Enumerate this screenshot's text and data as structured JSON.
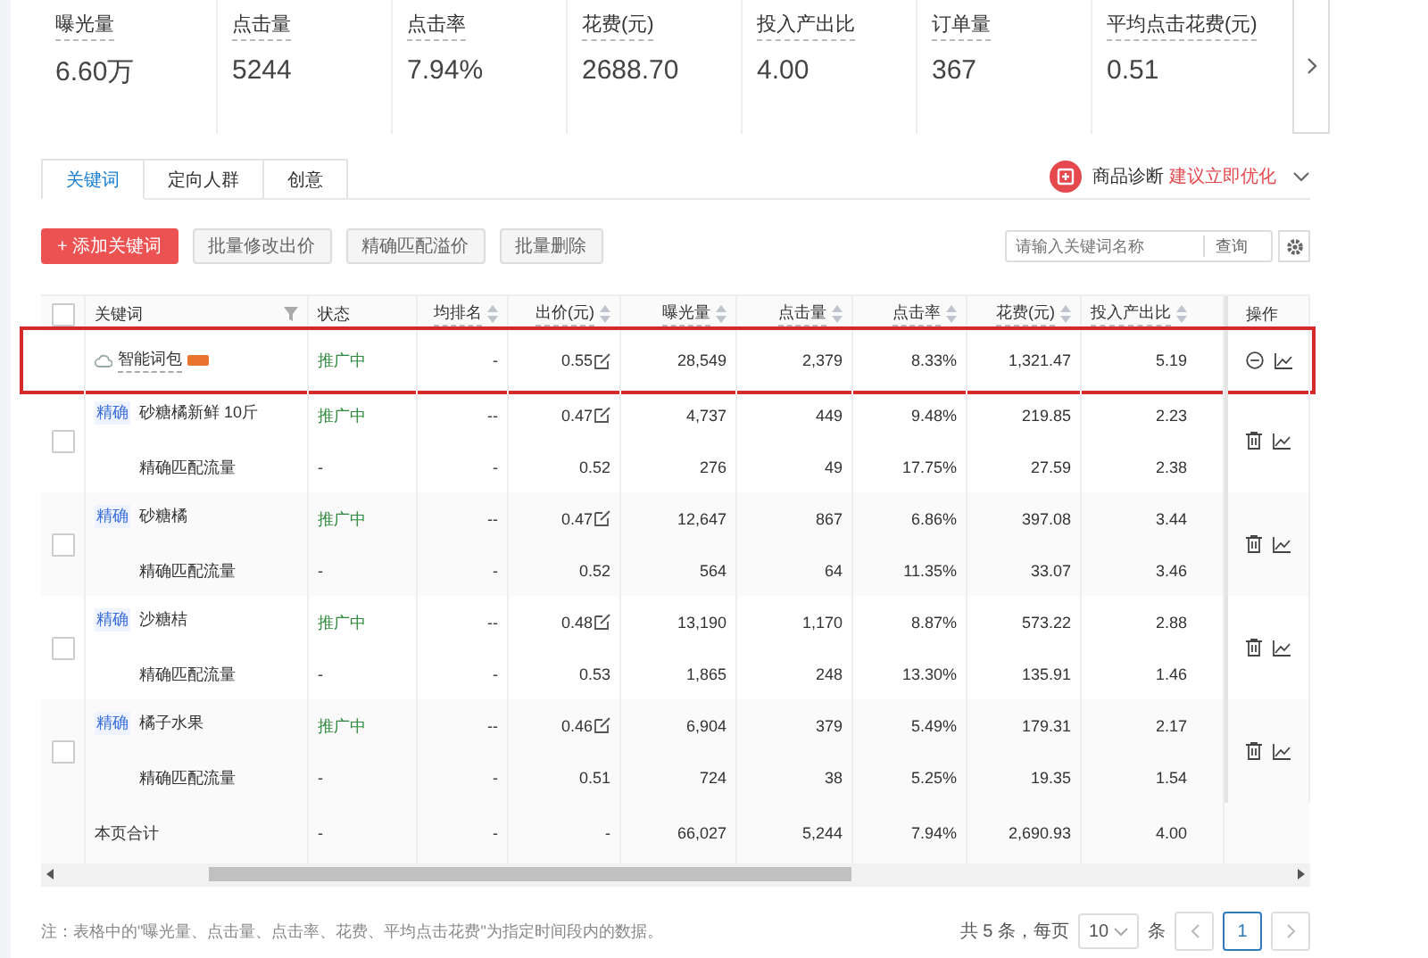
{
  "stats": [
    {
      "label": "曝光量",
      "value": "6.60万"
    },
    {
      "label": "点击量",
      "value": "5244"
    },
    {
      "label": "点击率",
      "value": "7.94%"
    },
    {
      "label": "花费(元)",
      "value": "2688.70"
    },
    {
      "label": "投入产出比",
      "value": "4.00"
    },
    {
      "label": "订单量",
      "value": "367"
    },
    {
      "label": "平均点击花费(元)",
      "value": "0.51"
    }
  ],
  "tabs": [
    {
      "label": "关键词",
      "selected": true
    },
    {
      "label": "定向人群",
      "selected": false
    },
    {
      "label": "创意",
      "selected": false
    }
  ],
  "diagnosis": {
    "label": "商品诊断",
    "link": "建议立即优化"
  },
  "toolbar": {
    "buttons": [
      {
        "label": "+ 添加关键词",
        "kind": "primary"
      },
      {
        "label": "批量修改出价",
        "kind": "default"
      },
      {
        "label": "精确匹配溢价",
        "kind": "default"
      },
      {
        "label": "批量删除",
        "kind": "default"
      }
    ],
    "search": {
      "placeholder": "请输入关键词名称",
      "button": "查询"
    }
  },
  "table": {
    "header_checkbox": {
      "checked": false
    },
    "columns": [
      {
        "label": "关键词",
        "sort": false,
        "filter": true
      },
      {
        "label": "状态",
        "sort": false,
        "filter": false
      },
      {
        "label": "均排名",
        "sort": true,
        "filter": false
      },
      {
        "label": "出价(元)",
        "sort": true,
        "filter": false
      },
      {
        "label": "曝光量",
        "sort": true,
        "filter": false
      },
      {
        "label": "点击量",
        "sort": true,
        "filter": false
      },
      {
        "label": "点击率",
        "sort": true,
        "filter": false
      },
      {
        "label": "花费(元)",
        "sort": true,
        "filter": false
      },
      {
        "label": "投入产出比",
        "sort": true,
        "filter": false
      },
      {
        "label": "操作",
        "sort": false,
        "filter": false
      }
    ],
    "rows": [
      {
        "kind": "smart",
        "highlighted": true,
        "cells": [
          "智能词包",
          "推广中",
          "-",
          "0.55",
          "28,549",
          "2,379",
          "8.33%",
          "1,321.47",
          "5.19"
        ]
      },
      {
        "kind": "keyword",
        "checked": false,
        "match": "精确",
        "cells": [
          "砂糖橘新鲜 10斤",
          "推广中",
          "--",
          "0.47",
          "4,737",
          "449",
          "9.48%",
          "219.85",
          "2.23"
        ],
        "sub_cells": [
          "精确匹配流量",
          "-",
          "-",
          "0.52",
          "276",
          "49",
          "17.75%",
          "27.59",
          "2.38"
        ]
      },
      {
        "kind": "keyword",
        "checked": false,
        "match": "精确",
        "cells": [
          "砂糖橘",
          "推广中",
          "--",
          "0.47",
          "12,647",
          "867",
          "6.86%",
          "397.08",
          "3.44"
        ],
        "sub_cells": [
          "精确匹配流量",
          "-",
          "-",
          "0.52",
          "564",
          "64",
          "11.35%",
          "33.07",
          "3.46"
        ]
      },
      {
        "kind": "keyword",
        "checked": false,
        "match": "精确",
        "cells": [
          "沙糖桔",
          "推广中",
          "--",
          "0.48",
          "13,190",
          "1,170",
          "8.87%",
          "573.22",
          "2.88"
        ],
        "sub_cells": [
          "精确匹配流量",
          "-",
          "-",
          "0.53",
          "1,865",
          "248",
          "13.30%",
          "135.91",
          "1.46"
        ]
      },
      {
        "kind": "keyword",
        "checked": false,
        "match": "精确",
        "cells": [
          "橘子水果",
          "推广中",
          "--",
          "0.46",
          "6,904",
          "379",
          "5.49%",
          "179.31",
          "2.17"
        ],
        "sub_cells": [
          "精确匹配流量",
          "-",
          "-",
          "0.51",
          "724",
          "38",
          "5.25%",
          "19.35",
          "1.54"
        ]
      },
      {
        "kind": "total",
        "cells": [
          "本页合计",
          "-",
          "-",
          "-",
          "66,027",
          "5,244",
          "7.94%",
          "2,690.93",
          "4.00"
        ]
      }
    ]
  },
  "footnote": "注：表格中的\"曝光量、点击量、点击率、花费、平均点击花费\"为指定时间段内的数据。",
  "pagination": {
    "summary": "共 5 条，每页",
    "page_size": "10",
    "unit": "条",
    "pages": [
      {
        "label": "1",
        "selected": true
      }
    ]
  }
}
